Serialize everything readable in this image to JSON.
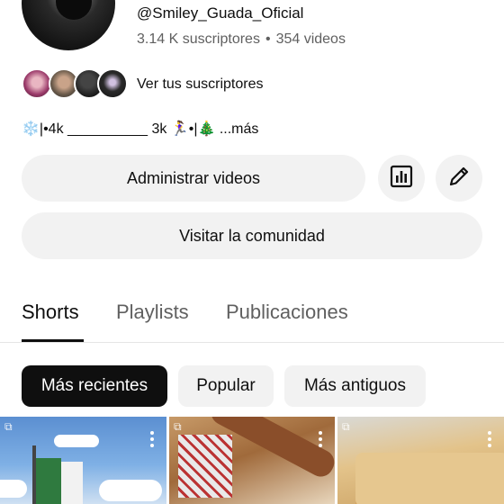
{
  "channel": {
    "handle": "@Smiley_Guada_Oficial",
    "subscribers": "3.14 K suscriptores",
    "separator": "•",
    "videos": "354 videos"
  },
  "subscribers_row": {
    "label": "Ver tus suscriptores"
  },
  "description": {
    "text": "❄️|•4k __________ 3k 🏃‍♀️•|🎄 ...más"
  },
  "actions": {
    "manage_label": "Administrar videos",
    "stats_icon": "analytics-icon",
    "edit_icon": "pencil-icon",
    "community_label": "Visitar la comunidad"
  },
  "tabs": [
    {
      "label": "Shorts",
      "active": true
    },
    {
      "label": "Playlists",
      "active": false
    },
    {
      "label": "Publicaciones",
      "active": false
    }
  ],
  "filters": [
    {
      "label": "Más recientes",
      "selected": true
    },
    {
      "label": "Popular",
      "selected": false
    },
    {
      "label": "Más antiguos",
      "selected": false
    }
  ],
  "thumbnails": [
    {
      "subject": "flag-sky"
    },
    {
      "subject": "baking-rolling-pin"
    },
    {
      "subject": "cake-slices"
    }
  ],
  "colors": {
    "text_primary": "#0f0f0f",
    "text_secondary": "#606060",
    "button_bg": "#f2f2f2",
    "chip_selected_bg": "#0f0f0f"
  }
}
